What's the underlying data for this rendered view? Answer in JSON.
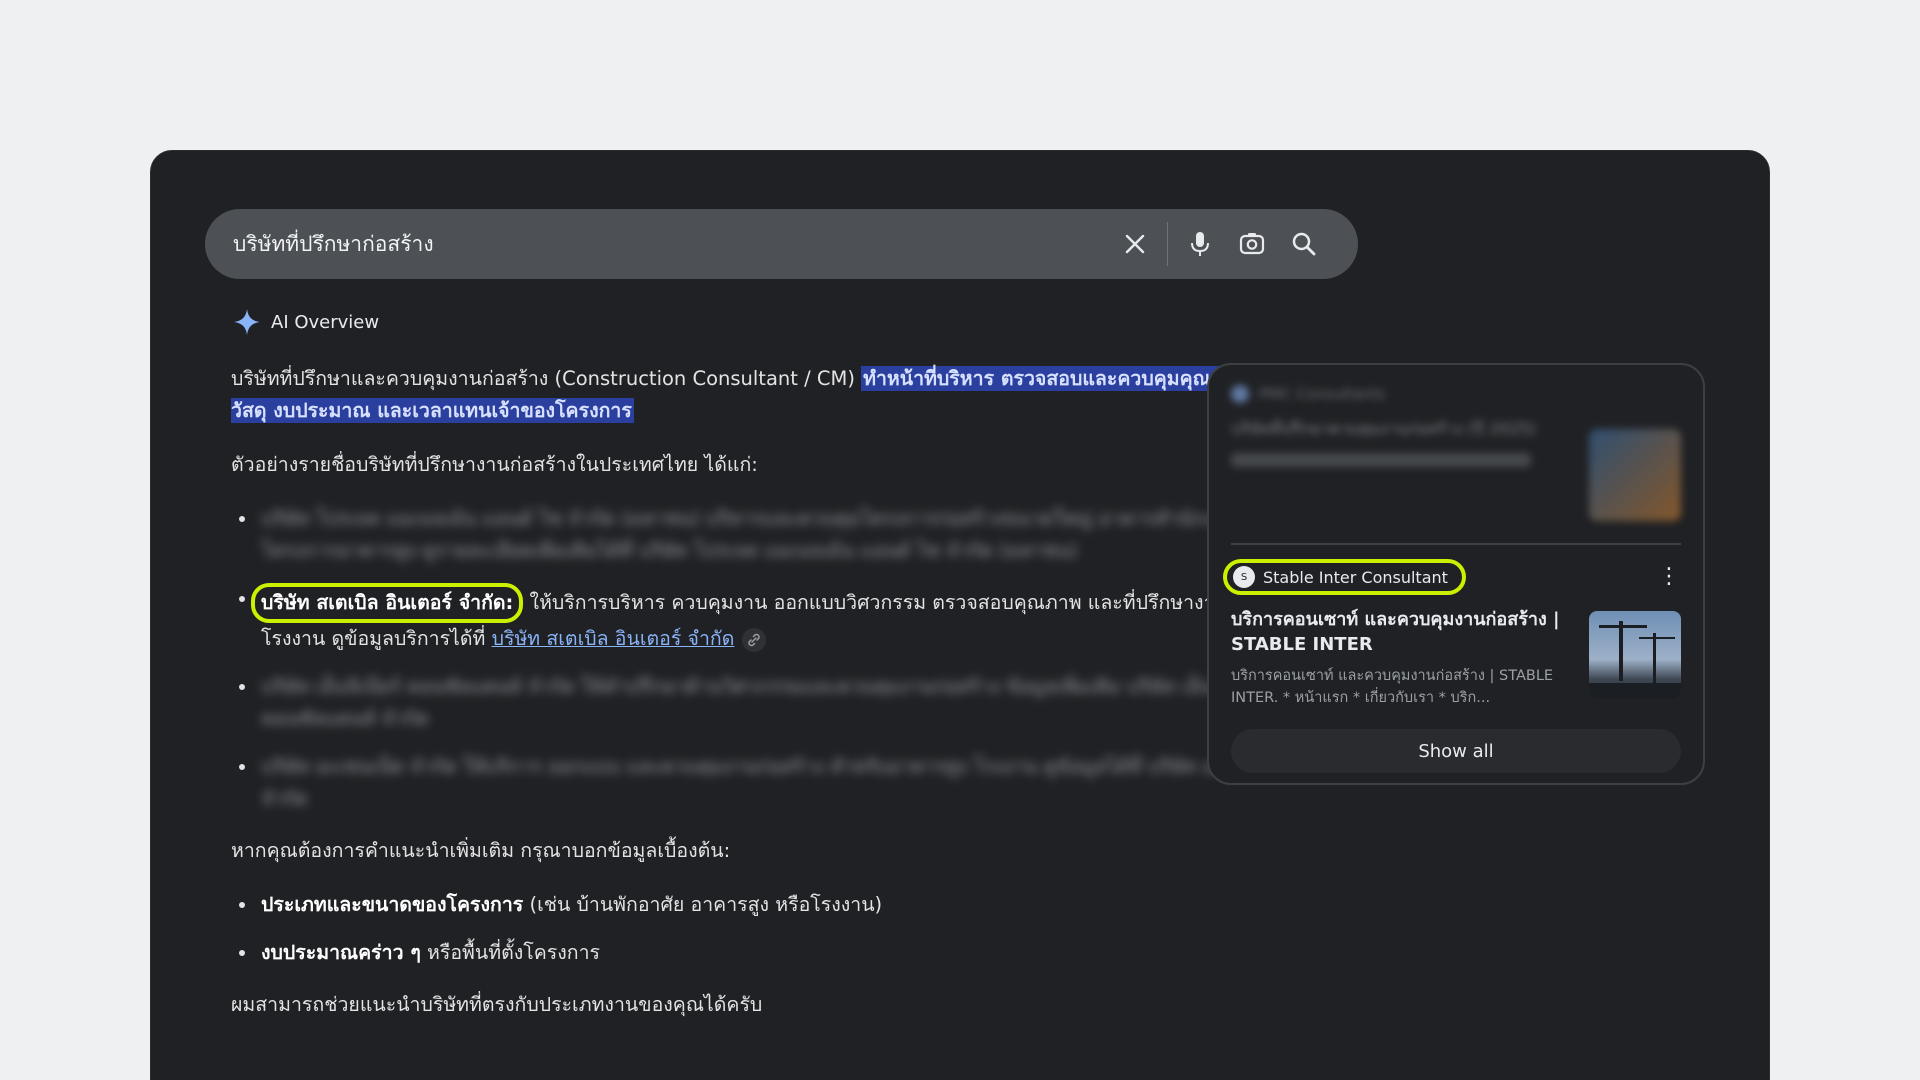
{
  "search": {
    "query": "บริษัทที่ปรึกษาก่อสร้าง"
  },
  "ai_overview": {
    "label": "AI Overview",
    "intro_plain": "บริษัทที่ปรึกษาและควบคุมงานก่อสร้าง (Construction Consultant / CM) ",
    "intro_highlight": "ทำหน้าที่บริหาร ตรวจสอบและควบคุมคุณภาพงาน วัสดุ งบประมาณ และเวลาแทนเจ้าของโครงการ",
    "examples_heading": "ตัวอย่างรายชื่อบริษัทที่ปรึกษางานก่อสร้างในประเทศไทย ได้แก่:",
    "item1_blurred": "บริษัท โปรเจค แมเนจเม้น แอนด์ ไซ จำกัด (มหาชน) บริหารและควบคุมโครงการก่อสร้างขนาดใหญ่ อาคารสำนักงาน และโครงการอาคารสูง ดูรายละเอียดเพิ่มเติมได้ที่ บริษัท โปรเจค แมเนจเม้น แอนด์ ไซ จำกัด (มหาชน)",
    "item2_name": "บริษัท สเตเบิล อินเตอร์ จำกัด:",
    "item2_text": " ให้บริการบริหาร ควบคุมงาน ออกแบบวิศวกรรม ตรวจสอบคุณภาพ และที่ปรึกษางานโรงงาน ดูข้อมูลบริการได้ที่ ",
    "item2_link": "บริษัท สเตเบิล อินเตอร์ จำกัด",
    "item3_blurred": "บริษัท เอ็นจิเนียร์ คอนซัลแตนท์ จำกัด ให้คำปรึกษาด้านวิศวกรรมและควบคุมงานก่อสร้าง ข้อมูลเพิ่มเติม บริษัท เอ็นจิเนียร์ คอนซัลแตนท์ จำกัด",
    "item4_blurred": "บริษัท อะเซนเน็ต จำกัด ให้บริการ ออกแบบ และควบคุมงานก่อสร้าง สำหรับอาคารสูง โรงงาน ดูข้อมูลได้ที่ บริษัท อะเซนเน็ต จำกัด",
    "more_info_heading": "หากคุณต้องการคำแนะนำเพิ่มเติม กรุณาบอกข้อมูลเบื้องต้น:",
    "tip1_bold": "ประเภทและขนาดของโครงการ",
    "tip1_rest": " (เช่น บ้านพักอาศัย อาคารสูง หรือโรงงาน)",
    "tip2_bold": "งบประมาณคร่าว ๆ",
    "tip2_rest": " หรือพื้นที่ตั้งโครงการ",
    "closing": "ผมสามารถช่วยแนะนำบริษัทที่ตรงกับประเภทงานของคุณได้ครับ"
  },
  "sources": {
    "blurred_source": "PMC Consultants",
    "blurred_title": "บริษัทที่ปรึกษาควบคุมงานก่อสร้าง (ปี 2025)",
    "source_name": "Stable Inter Consultant",
    "card_title": "บริการคอนเซาท์ และควบคุมงานก่อสร้าง | STABLE INTER",
    "card_snippet": "บริการคอนเซาท์ และควบคุมงานก่อสร้าง | STABLE INTER. * หน้าแรก * เกี่ยวกับเรา * บริก...",
    "show_all": "Show all"
  }
}
